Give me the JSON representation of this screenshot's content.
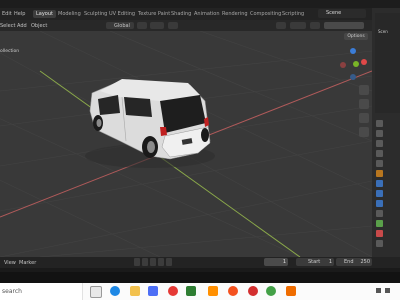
{
  "topbar": {
    "menus": [
      "Edit",
      "Help"
    ],
    "tabs": [
      "Layout",
      "Modeling",
      "Sculpting",
      "UV Editing",
      "Texture Paint",
      "Shading",
      "Animation",
      "Rendering",
      "Compositing",
      "Scripting"
    ],
    "active_tab": "Layout",
    "scene_label": "Scene"
  },
  "viewport_header": {
    "menus": [
      "Select",
      "Add",
      "Object"
    ],
    "orientation": "Global",
    "options_label": "Options",
    "collection_label": "ollection"
  },
  "viewport": {
    "grid_color": "#4a4a4a",
    "x_axis_color": "#b05a5a",
    "y_axis_color": "#8aa84a",
    "object": "car-model",
    "body_color": "#dedede",
    "gizmo": {
      "x_color": "#e04848",
      "y_color": "#79b427",
      "z_color": "#3b7dd8",
      "neg_color": "#8a4040"
    }
  },
  "timeline": {
    "menus": [
      "View",
      "Marker"
    ],
    "current_frame": "1",
    "start_label": "Start",
    "start_value": "1",
    "end_label": "End",
    "end_value": "250"
  },
  "taskbar": {
    "search_placeholder": "search",
    "icons": [
      "task-view-icon",
      "edge-icon",
      "file-explorer-icon",
      "store-icon",
      "mail-icon",
      "chrome-icon",
      "vlc-icon",
      "firefox-icon",
      "opera-icon",
      "chrome-icon-2",
      "blender-icon",
      "notes-icon"
    ]
  },
  "properties": {
    "outliner_label": "Scen"
  }
}
